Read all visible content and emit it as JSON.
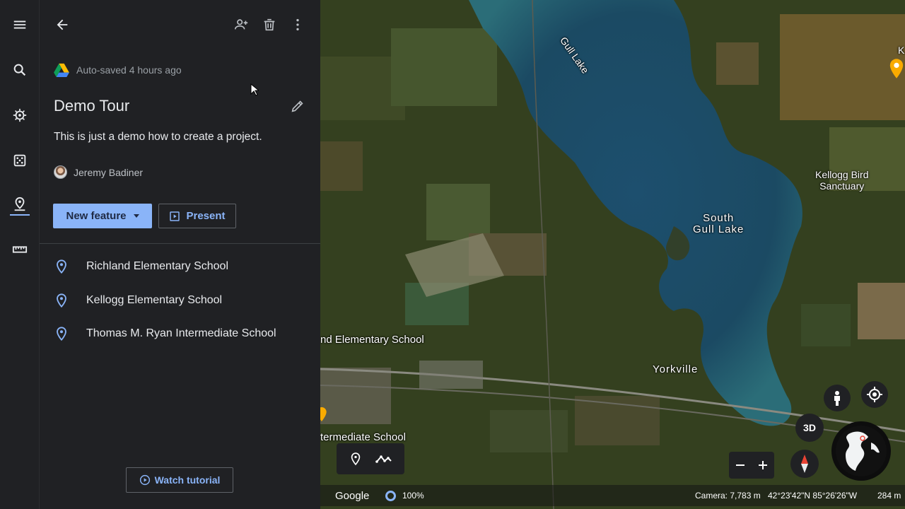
{
  "rail": {
    "items": [
      "menu-icon",
      "search-icon",
      "voyager-icon",
      "random-icon",
      "projects-icon",
      "measure-icon"
    ]
  },
  "project": {
    "autosave_text": "Auto-saved 4 hours ago",
    "title": "Demo Tour",
    "description": "This is just a demo how to create a project.",
    "author": "Jeremy Badiner",
    "new_feature_label": "New feature",
    "present_label": "Present",
    "features": [
      {
        "name": "Richland Elementary School"
      },
      {
        "name": "Kellogg Elementary School"
      },
      {
        "name": "Thomas M. Ryan Intermediate School"
      }
    ],
    "watch_tutorial_label": "Watch tutorial"
  },
  "map": {
    "labels": {
      "gull_lake": "Gull Lake",
      "kellogg_bird": "Kellogg Bird\nSanctuary",
      "south_gull_lake": "South\nGull Lake",
      "elementary_school": "nd Elementary School",
      "yorkville": "Yorkville",
      "intermediate_school": "termediate School",
      "edge_letter": "K"
    },
    "three_d_label": "3D",
    "google_label": "Google",
    "loading_percent": "100%",
    "camera": "Camera: 7,783 m",
    "coordinates": "42°23'42\"N 85°26'26\"W",
    "scale": "284 m"
  },
  "colors": {
    "accent": "#8ab4f8",
    "panel_bg": "#202124",
    "pin": "#f9ab00"
  }
}
